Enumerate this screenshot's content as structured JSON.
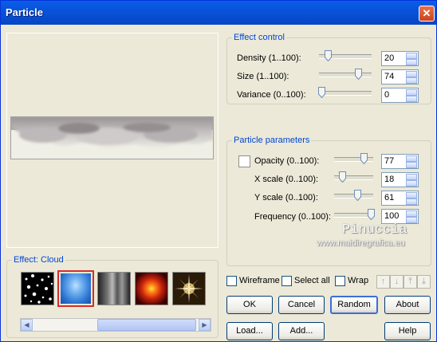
{
  "window": {
    "title": "Particle",
    "close_glyph": "✕"
  },
  "effect_control": {
    "label": "Effect control",
    "rows": [
      {
        "label": "Density (1..100):",
        "value": "20"
      },
      {
        "label": "Size (1..100):",
        "value": "74"
      },
      {
        "label": "Variance (0..100):",
        "value": "0"
      }
    ]
  },
  "particle_parameters": {
    "label": "Particle parameters",
    "rows": [
      {
        "label": "Opacity (0..100):",
        "value": "77"
      },
      {
        "label": "X scale (0..100):",
        "value": "18"
      },
      {
        "label": "Y scale (0..100):",
        "value": "61"
      },
      {
        "label": "Frequency (0..100):",
        "value": "100"
      }
    ]
  },
  "effect": {
    "label": "Effect: Cloud",
    "selected_index": 1,
    "thumbnails": [
      "stars-thumbnail",
      "cloud-thumbnail",
      "smoke-thumbnail",
      "fire-thumbnail",
      "sparkle-thumbnail"
    ]
  },
  "options": {
    "wireframe": "Wireframe",
    "select_all": "Select all",
    "wrap": "Wrap"
  },
  "arrow_icons": [
    "arrow-up-icon",
    "arrow-down-icon",
    "arrow-top-icon",
    "arrow-bottom-icon"
  ],
  "buttons": {
    "ok": "OK",
    "cancel": "Cancel",
    "random": "Random",
    "about": "About",
    "load": "Load...",
    "add": "Add...",
    "help": "Help"
  },
  "watermark": {
    "line1": "Pinuccia",
    "line2": "www.maidiregrafica.eu"
  },
  "colors": {
    "accent": "#0046d5",
    "titlebar": "#0853d9",
    "selected_border": "#d22d2d"
  }
}
